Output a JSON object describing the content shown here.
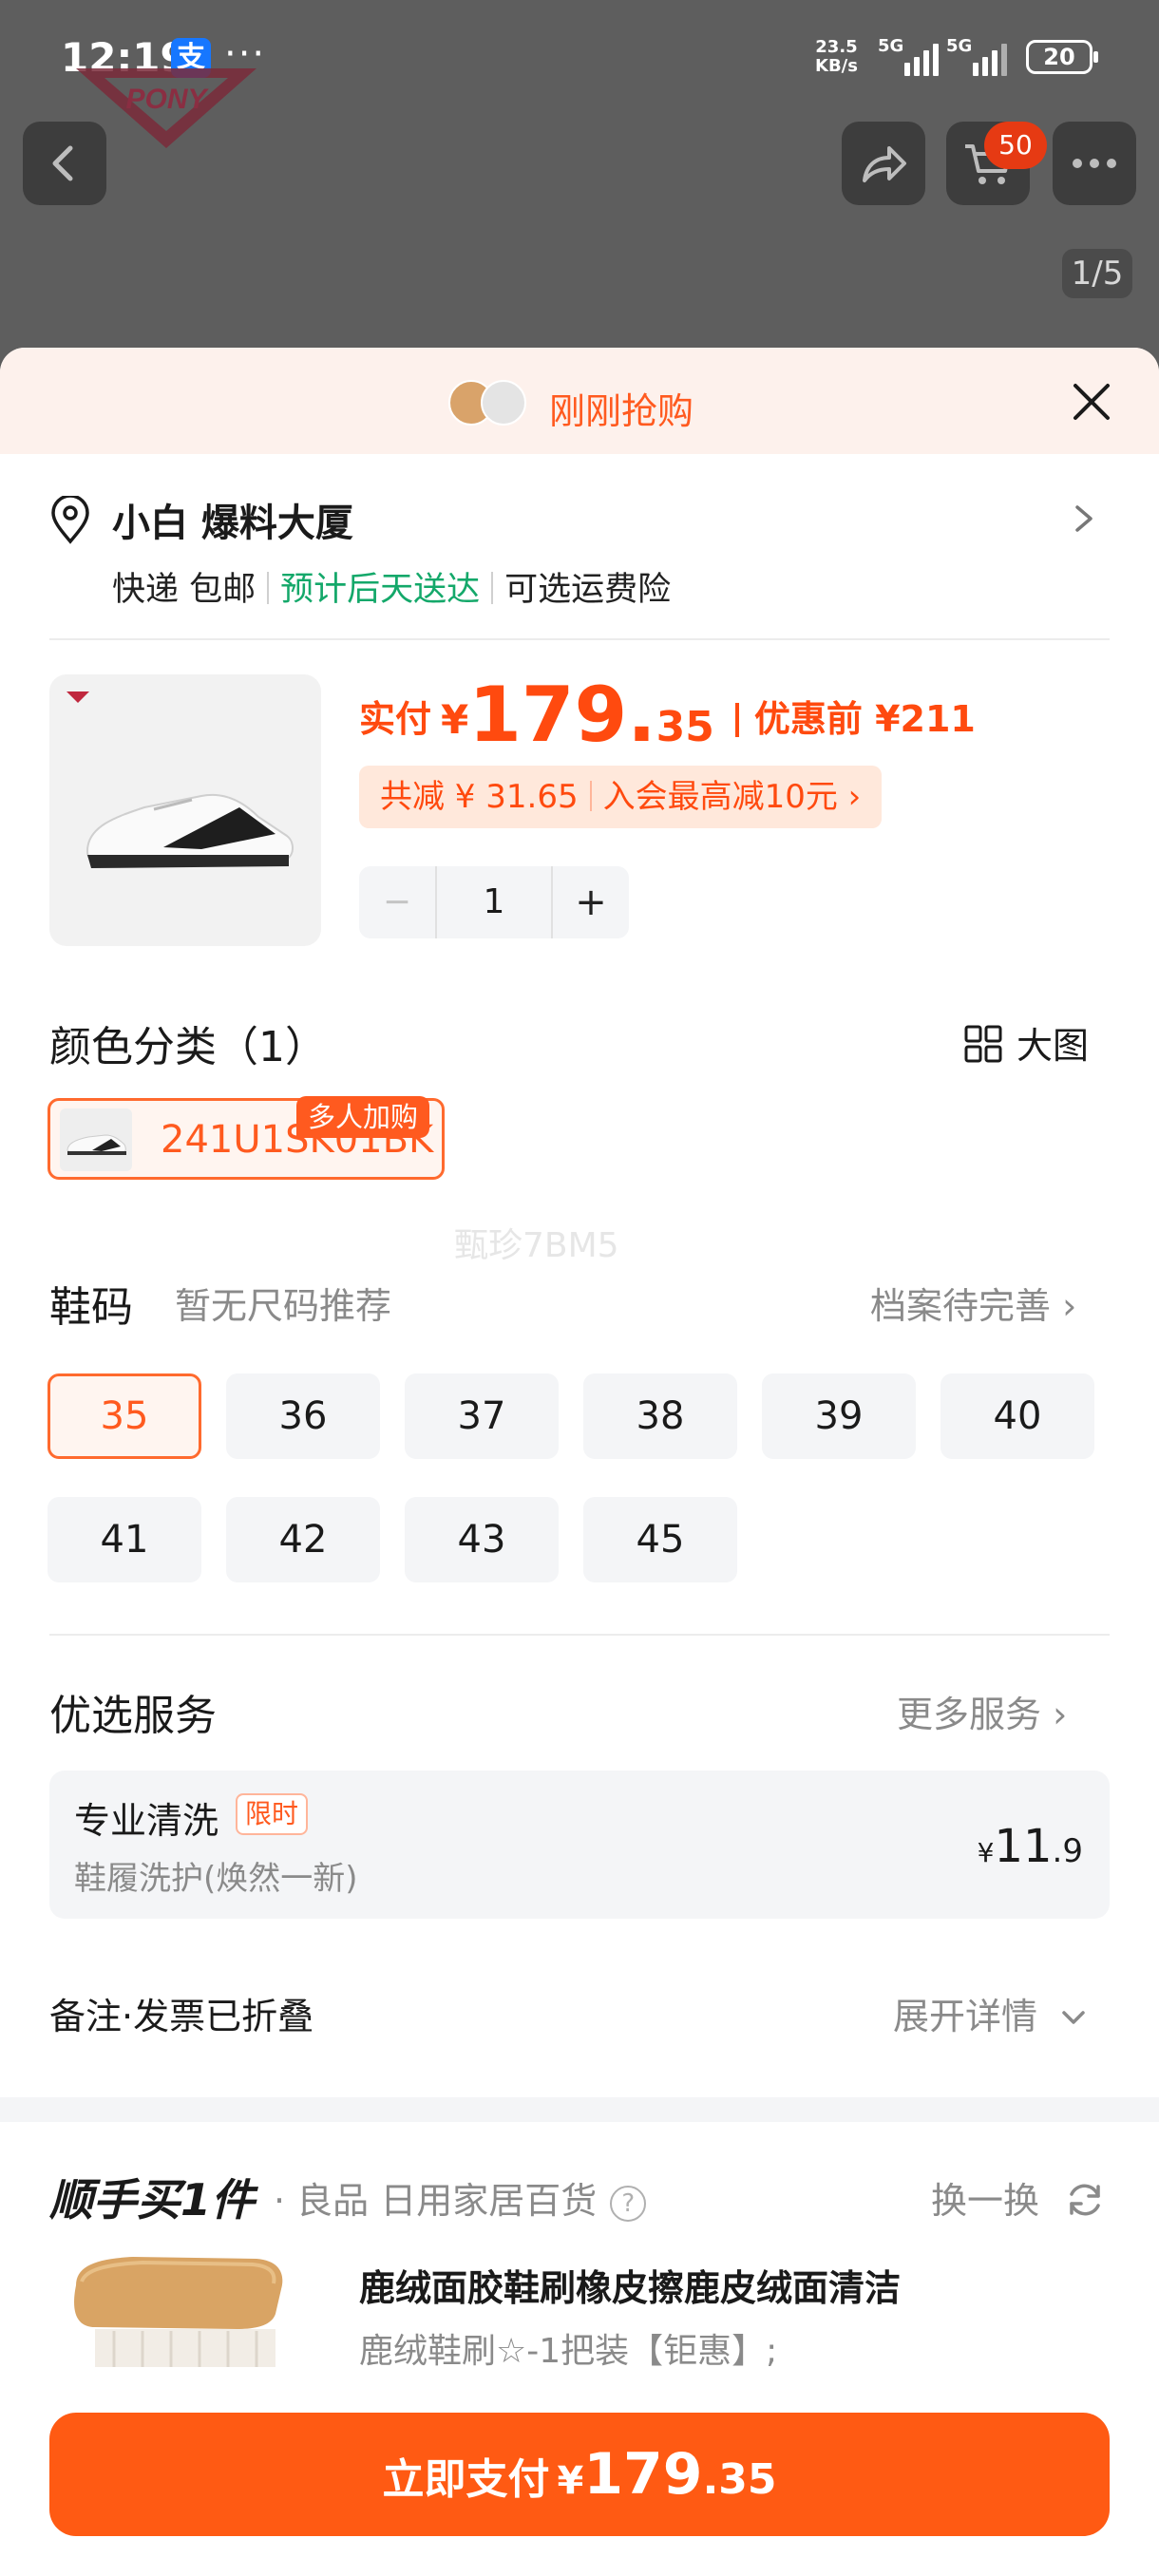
{
  "status_bar": {
    "time": "12:19",
    "app_badge": "支",
    "more_dots": "···",
    "net_speed_top": "23.5",
    "net_speed_unit": "KB/s",
    "sim1": "5G",
    "sim2": "5G",
    "battery": "20"
  },
  "background_page": {
    "cart_count": "50",
    "image_indicator": "1/5",
    "brand_logo": "PONY"
  },
  "sheet": {
    "header_title": "刚刚抢购",
    "address": {
      "name": "小白 爆料大厦",
      "shipping": [
        "快递 包邮",
        "预计后天送达",
        "可选运费险"
      ]
    },
    "product": {
      "paid_label": "实付",
      "currency": "¥",
      "price_int": "179.",
      "price_dec": "35",
      "before_label": "优惠前 ¥211",
      "saved": "共减 ¥ 31.65",
      "member_offer": "入会最高减10元",
      "chevron": "›",
      "quantity": "1",
      "minus": "−",
      "plus": "+"
    },
    "color": {
      "title": "颜色分类（1）",
      "big_view": "大图",
      "option": "241U1SK01BK",
      "tag": "多人加购"
    },
    "watermark": "甄珍7BM5",
    "size": {
      "title": "鞋码",
      "sub": "暂无尺码推荐",
      "profile": "档案待完善",
      "chevron": "›",
      "options": [
        "35",
        "36",
        "37",
        "38",
        "39",
        "40",
        "41",
        "42",
        "43",
        "45"
      ],
      "selected": "35"
    },
    "service": {
      "title": "优选服务",
      "more": "更多服务",
      "chevron": "›",
      "name": "专业清洗",
      "tag": "限时",
      "desc": "鞋履洗护(焕然一新)",
      "currency": "¥",
      "price_int": "11",
      "price_dec": ".9"
    },
    "note": {
      "label": "备注·发票已折叠",
      "expand": "展开详情"
    },
    "addon": {
      "logo_a": "顺手买",
      "logo_b": "1件",
      "category": "· 良品  日用家居百货",
      "help": "?",
      "swap": "换一换",
      "title": "鹿绒面胶鞋刷橡皮擦鹿皮绒面清洁",
      "subtitle": "鹿绒鞋刷☆-1把装【钜惠】;"
    },
    "pay": {
      "label": "立即支付",
      "currency": "¥",
      "price_int": "179",
      "price_dec": ".35"
    }
  },
  "colors": {
    "accent": "#ff5a13",
    "accent_soft": "#fff5f0",
    "green": "#14a86a",
    "muted": "#8a8a8a"
  }
}
